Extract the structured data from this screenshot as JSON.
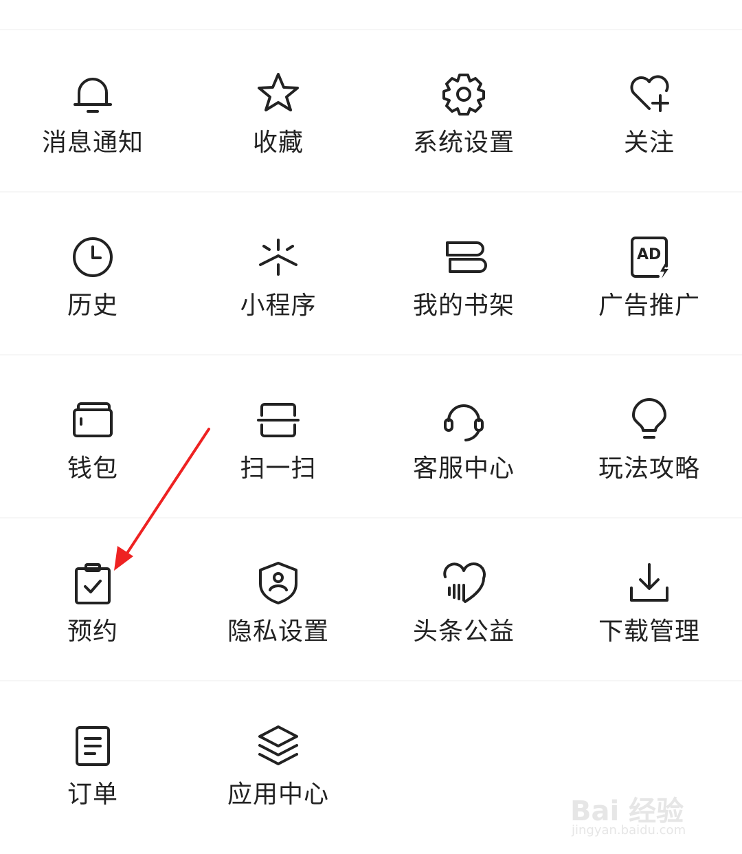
{
  "grid": {
    "items": [
      {
        "label": "消息通知",
        "icon": "bell-icon"
      },
      {
        "label": "收藏",
        "icon": "star-icon"
      },
      {
        "label": "系统设置",
        "icon": "gear-icon"
      },
      {
        "label": "关注",
        "icon": "heart-plus-icon"
      },
      {
        "label": "历史",
        "icon": "clock-icon"
      },
      {
        "label": "小程序",
        "icon": "mini-program-icon"
      },
      {
        "label": "我的书架",
        "icon": "bookshelf-icon"
      },
      {
        "label": "广告推广",
        "icon": "ad-icon"
      },
      {
        "label": "钱包",
        "icon": "wallet-icon"
      },
      {
        "label": "扫一扫",
        "icon": "scan-icon"
      },
      {
        "label": "客服中心",
        "icon": "headset-icon"
      },
      {
        "label": "玩法攻略",
        "icon": "lightbulb-icon"
      },
      {
        "label": "预约",
        "icon": "clipboard-check-icon"
      },
      {
        "label": "隐私设置",
        "icon": "shield-user-icon"
      },
      {
        "label": "头条公益",
        "icon": "charity-heart-icon"
      },
      {
        "label": "下载管理",
        "icon": "download-icon"
      },
      {
        "label": "订单",
        "icon": "order-icon"
      },
      {
        "label": "应用中心",
        "icon": "layers-icon"
      }
    ]
  },
  "annotation": {
    "color": "#ee2222"
  },
  "watermark": {
    "main": "Bai 经验",
    "sub": "jingyan.baidu.com"
  }
}
